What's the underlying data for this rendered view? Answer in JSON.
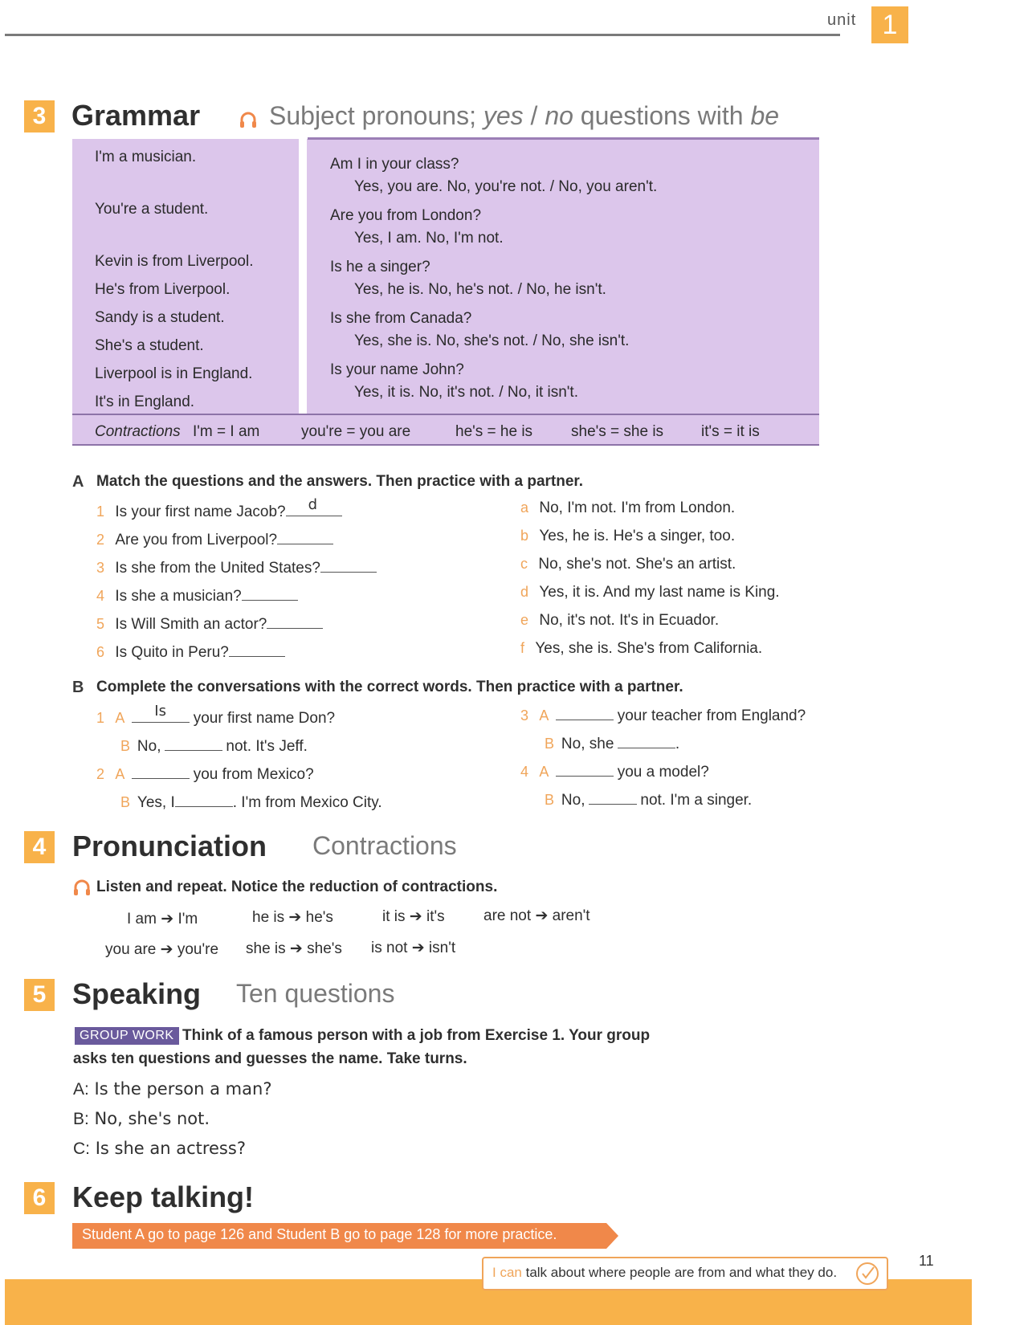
{
  "header": {
    "unit_label": "unit",
    "unit_number": "1"
  },
  "grammar": {
    "number": "3",
    "title": "Grammar",
    "subtitle_a": "Subject pronouns; ",
    "subtitle_yes": "yes",
    "subtitle_slash": " / ",
    "subtitle_no": "no",
    "subtitle_b": " questions with ",
    "subtitle_be": "be",
    "left": [
      "I'm a musician.",
      "You're a student.",
      "Kevin is from Liverpool.",
      "He's from Liverpool.",
      "Sandy is a student.",
      "She's a student.",
      "Liverpool is in England.",
      "It's in England."
    ],
    "questions": [
      "Am I in your class?",
      "Are you from London?",
      "Is he a singer?",
      "Is she from Canada?",
      "Is your name John?"
    ],
    "answers": [
      "Yes, you are. No, you're not. / No, you aren't.",
      "Yes, I am. No, I'm not.",
      "Yes, he is. No, he's not. / No, he isn't.",
      "Yes, she is. No, she's not. / No, she isn't.",
      "Yes, it is. No, it's not. / No, it isn't."
    ],
    "contractions_label": "Contractions",
    "contractions": [
      "I'm = I am",
      "you're = you are",
      "he's = he is",
      "she's = she is",
      "it's = it is"
    ]
  },
  "exercise_a": {
    "letter": "A",
    "instruction": "Match the questions and the answers. Then practice with a partner.",
    "questions": [
      {
        "n": "1",
        "text": "Is your first name Jacob?",
        "answer": "d"
      },
      {
        "n": "2",
        "text": "Are you from Liverpool?",
        "answer": ""
      },
      {
        "n": "3",
        "text": "Is she from the United States?",
        "answer": ""
      },
      {
        "n": "4",
        "text": "Is she a musician?",
        "answer": ""
      },
      {
        "n": "5",
        "text": "Is Will Smith an actor?",
        "answer": ""
      },
      {
        "n": "6",
        "text": "Is Quito in Peru?",
        "answer": ""
      }
    ],
    "answers": [
      {
        "l": "a",
        "text": "No, I'm not. I'm from London."
      },
      {
        "l": "b",
        "text": "Yes, he is. He's a singer, too."
      },
      {
        "l": "c",
        "text": "No, she's not. She's an artist."
      },
      {
        "l": "d",
        "text": "Yes, it is. And my last name is King."
      },
      {
        "l": "e",
        "text": "No, it's not. It's in Ecuador."
      },
      {
        "l": "f",
        "text": "Yes, she is. She's from California."
      }
    ]
  },
  "exercise_b": {
    "letter": "B",
    "instruction": "Complete the conversations with the correct words. Then practice with a partner.",
    "c1": {
      "n": "1",
      "a_after": "your first name Don?",
      "a_fill": "Is",
      "b_before": "No,",
      "b_after": "not. It's Jeff."
    },
    "c2": {
      "n": "2",
      "a_after": "you from Mexico?",
      "b_before": "Yes, I",
      "b_after": ". I'm from Mexico City."
    },
    "c3": {
      "n": "3",
      "a_after": "your teacher from England?",
      "b_before": "No, she",
      "b_after": "."
    },
    "c4": {
      "n": "4",
      "a_after": "you a model?",
      "b_before": "No,",
      "b_after": "not. I'm a singer."
    },
    "speaker_a": "A",
    "speaker_b": "B"
  },
  "pronunciation": {
    "number": "4",
    "title": "Pronunciation",
    "subtitle": "Contractions",
    "instruction": "Listen and repeat. Notice the reduction of contractions.",
    "row1": [
      [
        "I am",
        "I'm"
      ],
      [
        "he is",
        "he's"
      ],
      [
        "it is",
        "it's"
      ],
      [
        "are not",
        "aren't"
      ]
    ],
    "row2": [
      [
        "you are",
        "you're"
      ],
      [
        "she is",
        "she's"
      ],
      [
        "is not",
        "isn't"
      ]
    ]
  },
  "speaking": {
    "number": "5",
    "title": "Speaking",
    "subtitle": "Ten questions",
    "badge": "GROUP WORK",
    "instruction_1": "Think of a famous person with a job from Exercise 1. Your group",
    "instruction_2": "asks ten questions and guesses the name. Take turns.",
    "dialog": [
      {
        "s": "A:",
        "t": "Is the person a man?"
      },
      {
        "s": "B:",
        "t": "No, she's not."
      },
      {
        "s": "C:",
        "t": "Is she an actress?"
      }
    ]
  },
  "keep_talking": {
    "number": "6",
    "title": "Keep talking!",
    "banner": "Student A go to page 126 and Student B go to page 128 for more practice."
  },
  "footer": {
    "i_can": "I can",
    "can_text": "talk about where people are from and what they do.",
    "page_number": "11"
  },
  "colors": {
    "accent": "#f8b24a",
    "grammar_bg": "#dcc6eb",
    "badge": "#6a5a9c",
    "banner": "#f0884a"
  }
}
